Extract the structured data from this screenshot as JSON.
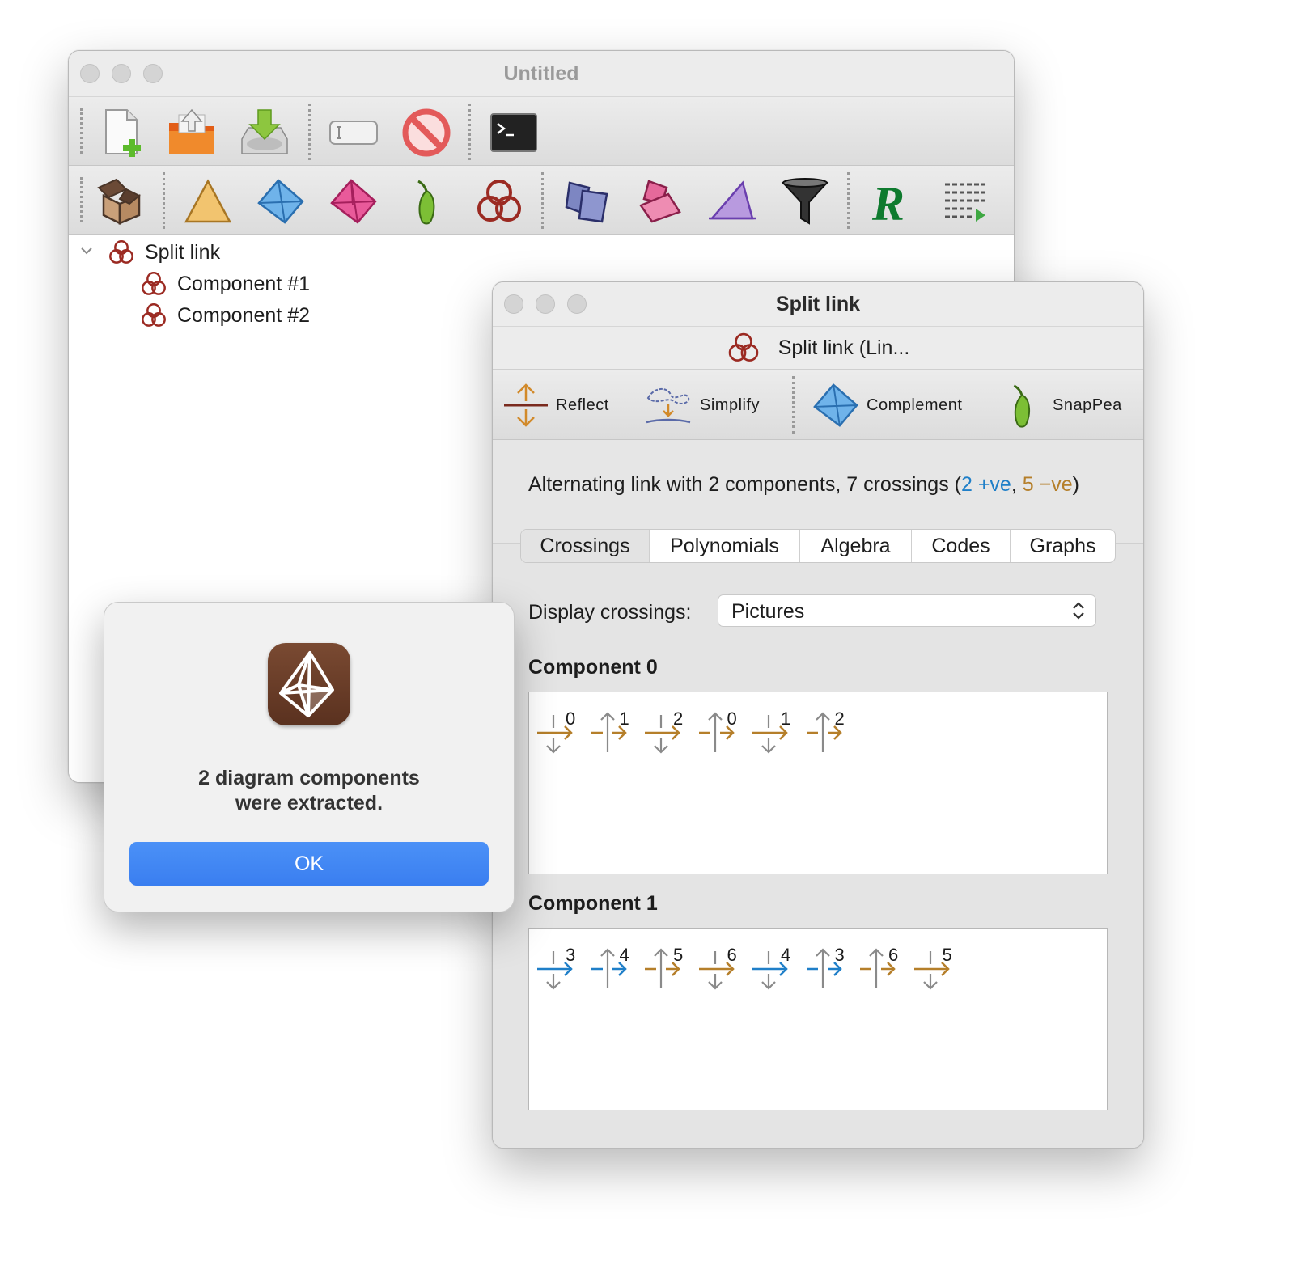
{
  "main_window": {
    "title": "Untitled",
    "toolbar1_icons": [
      "new-document-icon",
      "open-folder-icon",
      "save-download-icon",
      "rename-field-icon",
      "delete-prohibited-icon",
      "terminal-icon"
    ],
    "toolbar2_icons": [
      "container-box-icon",
      "triangulation-2d-icon",
      "triangulation-3d-icon",
      "triangulation-4d-icon",
      "snappea-pepper-icon",
      "link-trefoil-icon",
      "surfaces-icon",
      "hypersurfaces-icon",
      "angle-structures-icon",
      "filter-funnel-icon",
      "r-script-icon",
      "text-document-icon"
    ],
    "tree": {
      "root": "Split link",
      "children": [
        "Component #1",
        "Component #2"
      ]
    }
  },
  "link_window": {
    "title": "Split link",
    "header_label": "Split link (Lin...",
    "actions": [
      {
        "label": "Reflect",
        "icon": "reflect-icon"
      },
      {
        "label": "Simplify",
        "icon": "simplify-icon"
      },
      {
        "label": "Complement",
        "icon": "complement-tetrahedron-icon"
      },
      {
        "label": "SnapPea",
        "icon": "snappea-pepper-icon"
      }
    ],
    "summary": {
      "prefix": "Alternating link with 2 components, 7 crossings (",
      "positive": "2 +ve",
      "separator": ", ",
      "negative": "5 −ve",
      "suffix": ")"
    },
    "tabs": [
      "Crossings",
      "Polynomials",
      "Algebra",
      "Codes",
      "Graphs"
    ],
    "selected_tab": "Crossings",
    "display_label": "Display crossings:",
    "display_value": "Pictures",
    "components": [
      {
        "heading": "Component 0",
        "crossings": [
          {
            "label": "0",
            "kind": "under-negative"
          },
          {
            "label": "1",
            "kind": "over-negative"
          },
          {
            "label": "2",
            "kind": "under-negative"
          },
          {
            "label": "0",
            "kind": "over-negative"
          },
          {
            "label": "1",
            "kind": "under-negative"
          },
          {
            "label": "2",
            "kind": "over-negative"
          }
        ]
      },
      {
        "heading": "Component 1",
        "crossings": [
          {
            "label": "3",
            "kind": "under-positive"
          },
          {
            "label": "4",
            "kind": "over-positive"
          },
          {
            "label": "5",
            "kind": "over-negative"
          },
          {
            "label": "6",
            "kind": "under-negative"
          },
          {
            "label": "4",
            "kind": "under-positive"
          },
          {
            "label": "3",
            "kind": "over-positive"
          },
          {
            "label": "6",
            "kind": "over-negative"
          },
          {
            "label": "5",
            "kind": "under-negative"
          }
        ]
      }
    ]
  },
  "alert": {
    "icon": "regina-app-icon",
    "message_line1": "2 diagram components",
    "message_line2": "were extracted.",
    "ok_label": "OK"
  },
  "colors": {
    "positive": "#1f7fc8",
    "negative": "#b57f2a",
    "accent": "#3b82f6",
    "link_icon": "#9b2a22"
  }
}
